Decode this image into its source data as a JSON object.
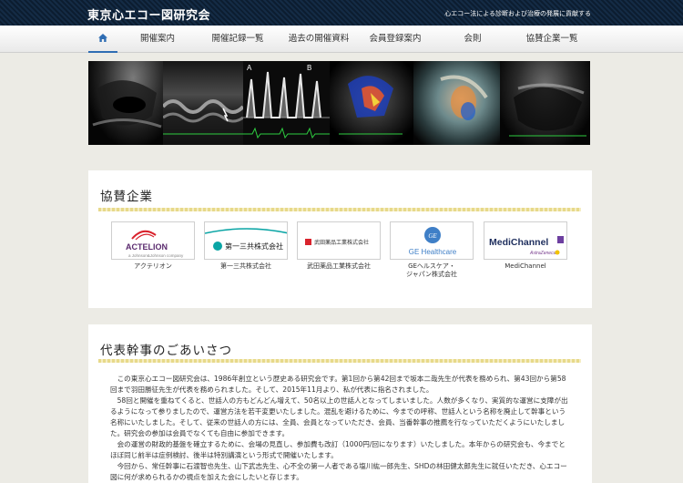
{
  "header": {
    "site_title": "東京心エコー図研究会",
    "tagline": "心エコー法による診断および治療の発展に貢献する"
  },
  "nav": {
    "home_icon": "home-icon",
    "items": [
      {
        "label": "開催案内"
      },
      {
        "label": "開催記録一覧"
      },
      {
        "label": "過去の開催資料"
      },
      {
        "label": "会員登録案内"
      },
      {
        "label": "会則"
      },
      {
        "label": "協賛企業一覧"
      }
    ]
  },
  "banner": {
    "panel_labels": [
      "A",
      "B"
    ]
  },
  "sponsors": {
    "title": "協賛企業",
    "items": [
      {
        "name": "アクテリオン",
        "logo_text": "ACTELION",
        "logo_subtext": "a Johnson&Johnson company"
      },
      {
        "name": "第一三共株式会社",
        "logo_text": "第一三共株式会社"
      },
      {
        "name": "武田薬品工業株式会社",
        "logo_text": "武田薬品工業株式会社"
      },
      {
        "name": "GEヘルスケア・ジャパン株式会社",
        "name_line1": "GEヘルスケア・",
        "name_line2": "ジャパン株式会社",
        "logo_text": "GE Healthcare",
        "logo_mark": "GE"
      },
      {
        "name": "MediChannel",
        "logo_text": "MediChannel",
        "logo_subtext": "AstraZeneca"
      }
    ]
  },
  "greeting": {
    "title": "代表幹事のごあいさつ",
    "paragraphs": [
      "この東京心エコー図研究会は、1986年創立という歴史ある研究会です。第1回から第42回まで坂本二哉先生が代表を務められ、第43回から第58回まで羽田勝征先生が代表を務められました。そして、2015年11月より、私が代表に指名されました。",
      "58回と開催を重ねてくると、世話人の方もどんどん増えて、50名以上の世話人となってしまいました。人数が多くなり、実質的な運営に支障が出るようになって参りましたので、運営方法を若干変更いたしました。混乱を避けるために、今までの呼称、世話人という名称を廃止して幹事という名称にいたしました。そして、従来の世話人の方には、全員、会員となっていただき、会員、当番幹事の推薦を行なっていただくようにいたしました。研究会の参加は会員でなくても自由に参加できます。",
      "会の運営の財政的基盤を確立するために、会場の見直し、参加費も改訂（1000円/回になります）いたしました。本年からの研究会も、今までとほぼ同じ前半は症例検討、後半は特別講演という形式で開催いたします。",
      "今回から、常任幹事に石渡智也先生、山下武志先生、心不全の第一人者である塩川紘一郎先生、SHDの林田健太郎先生に就任いただき、心エコー図に何が求められるかの視点を加えた会にしたいと存じます。"
    ]
  },
  "colors": {
    "topbar": "#0f2338",
    "nav_active": "#2f6db3",
    "rule": "#e7d98a",
    "page_bg": "#ecebe5"
  }
}
